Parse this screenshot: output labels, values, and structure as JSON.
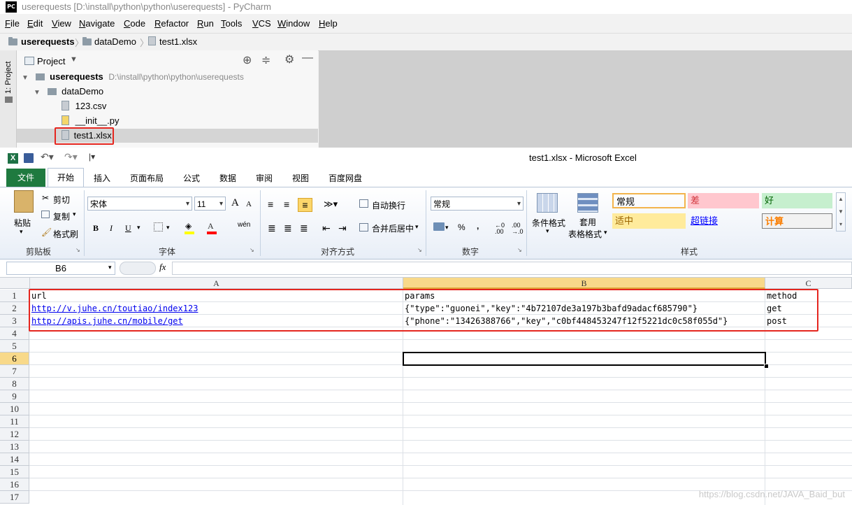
{
  "pycharm": {
    "logo": "PC",
    "window_title": "userequests [D:\\install\\python\\python\\userequests] - PyCharm",
    "menu": [
      {
        "hot": "F",
        "rest": "ile"
      },
      {
        "hot": "E",
        "rest": "dit"
      },
      {
        "hot": "V",
        "rest": "iew"
      },
      {
        "hot": "N",
        "rest": "avigate"
      },
      {
        "hot": "C",
        "rest": "ode"
      },
      {
        "hot": "R",
        "rest": "efactor"
      },
      {
        "hot": "R",
        "rest": "un"
      },
      {
        "hot": "T",
        "rest": "ools"
      },
      {
        "hot": "V",
        "rest": "CS"
      },
      {
        "hot": "W",
        "rest": "indow"
      },
      {
        "hot": "H",
        "rest": "elp"
      }
    ],
    "breadcrumb": [
      "userequests",
      "dataDemo",
      "test1.xlsx"
    ],
    "tool_strip_label": "1: Project",
    "project_panel": {
      "title": "Project",
      "tree": {
        "root_name": "userequests",
        "root_path": "D:\\install\\python\\python\\userequests",
        "folder": "dataDemo",
        "files": [
          "123.csv",
          "__init__.py",
          "test1.xlsx"
        ]
      }
    }
  },
  "excel": {
    "title": "test1.xlsx  -  Microsoft Excel",
    "ribbon_tabs": [
      "文件",
      "开始",
      "插入",
      "页面布局",
      "公式",
      "数据",
      "审阅",
      "视图",
      "百度网盘"
    ],
    "active_tab": "开始",
    "clipboard": {
      "paste": "粘贴",
      "cut": "剪切",
      "copy": "复制",
      "format_painter": "格式刷",
      "label": "剪贴板"
    },
    "font": {
      "name": "宋体",
      "size": "11",
      "label": "字体",
      "bold": "B",
      "italic": "I",
      "underline": "U",
      "grow": "A",
      "shrink": "A",
      "wen": "wén"
    },
    "alignment": {
      "wrap": "自动换行",
      "merge": "合并后居中",
      "label": "对齐方式"
    },
    "number": {
      "format": "常规",
      "percent": "%",
      "comma": ",",
      "label": "数字"
    },
    "styles": {
      "conditional": "条件格式",
      "table": "套用",
      "table2": "表格格式",
      "label": "样式",
      "cells": [
        {
          "text": "常规",
          "bg": "#ffffff",
          "color": "#000000"
        },
        {
          "text": "差",
          "bg": "#ffc7ce",
          "color": "#9c0006"
        },
        {
          "text": "好",
          "bg": "#c6efce",
          "color": "#006100"
        },
        {
          "text": "适中",
          "bg": "#ffeb9c",
          "color": "#9c6500"
        },
        {
          "text": "超链接",
          "bg": "#ffffff",
          "color": "#0000ff"
        },
        {
          "text": "计算",
          "bg": "#f2f2f2",
          "color": "#fa7d00"
        }
      ]
    },
    "formula_bar": {
      "name_box": "B6",
      "fx": "fx",
      "value": ""
    },
    "columns": [
      "A",
      "B",
      "C"
    ],
    "row_numbers": [
      "1",
      "2",
      "3",
      "4",
      "5",
      "6",
      "7",
      "8",
      "9",
      "10",
      "11",
      "12",
      "13",
      "14",
      "15",
      "16",
      "17"
    ],
    "rows": [
      {
        "a": "url",
        "b": "params",
        "c": "method"
      },
      {
        "a": "http://v.juhe.cn/toutiao/index123",
        "b": "{\"type\":\"guonei\",\"key\":\"4b72107de3a197b3bafd9adacf685790\"}",
        "c": "get"
      },
      {
        "a": "http://apis.juhe.cn/mobile/get",
        "b": "{\"phone\":\"13426388766\",\"key\",\"c0bf448453247f12f5221dc0c58f055d\"}",
        "c": "post"
      }
    ]
  },
  "watermark": "https://blog.csdn.net/JAVA_Baid_but"
}
